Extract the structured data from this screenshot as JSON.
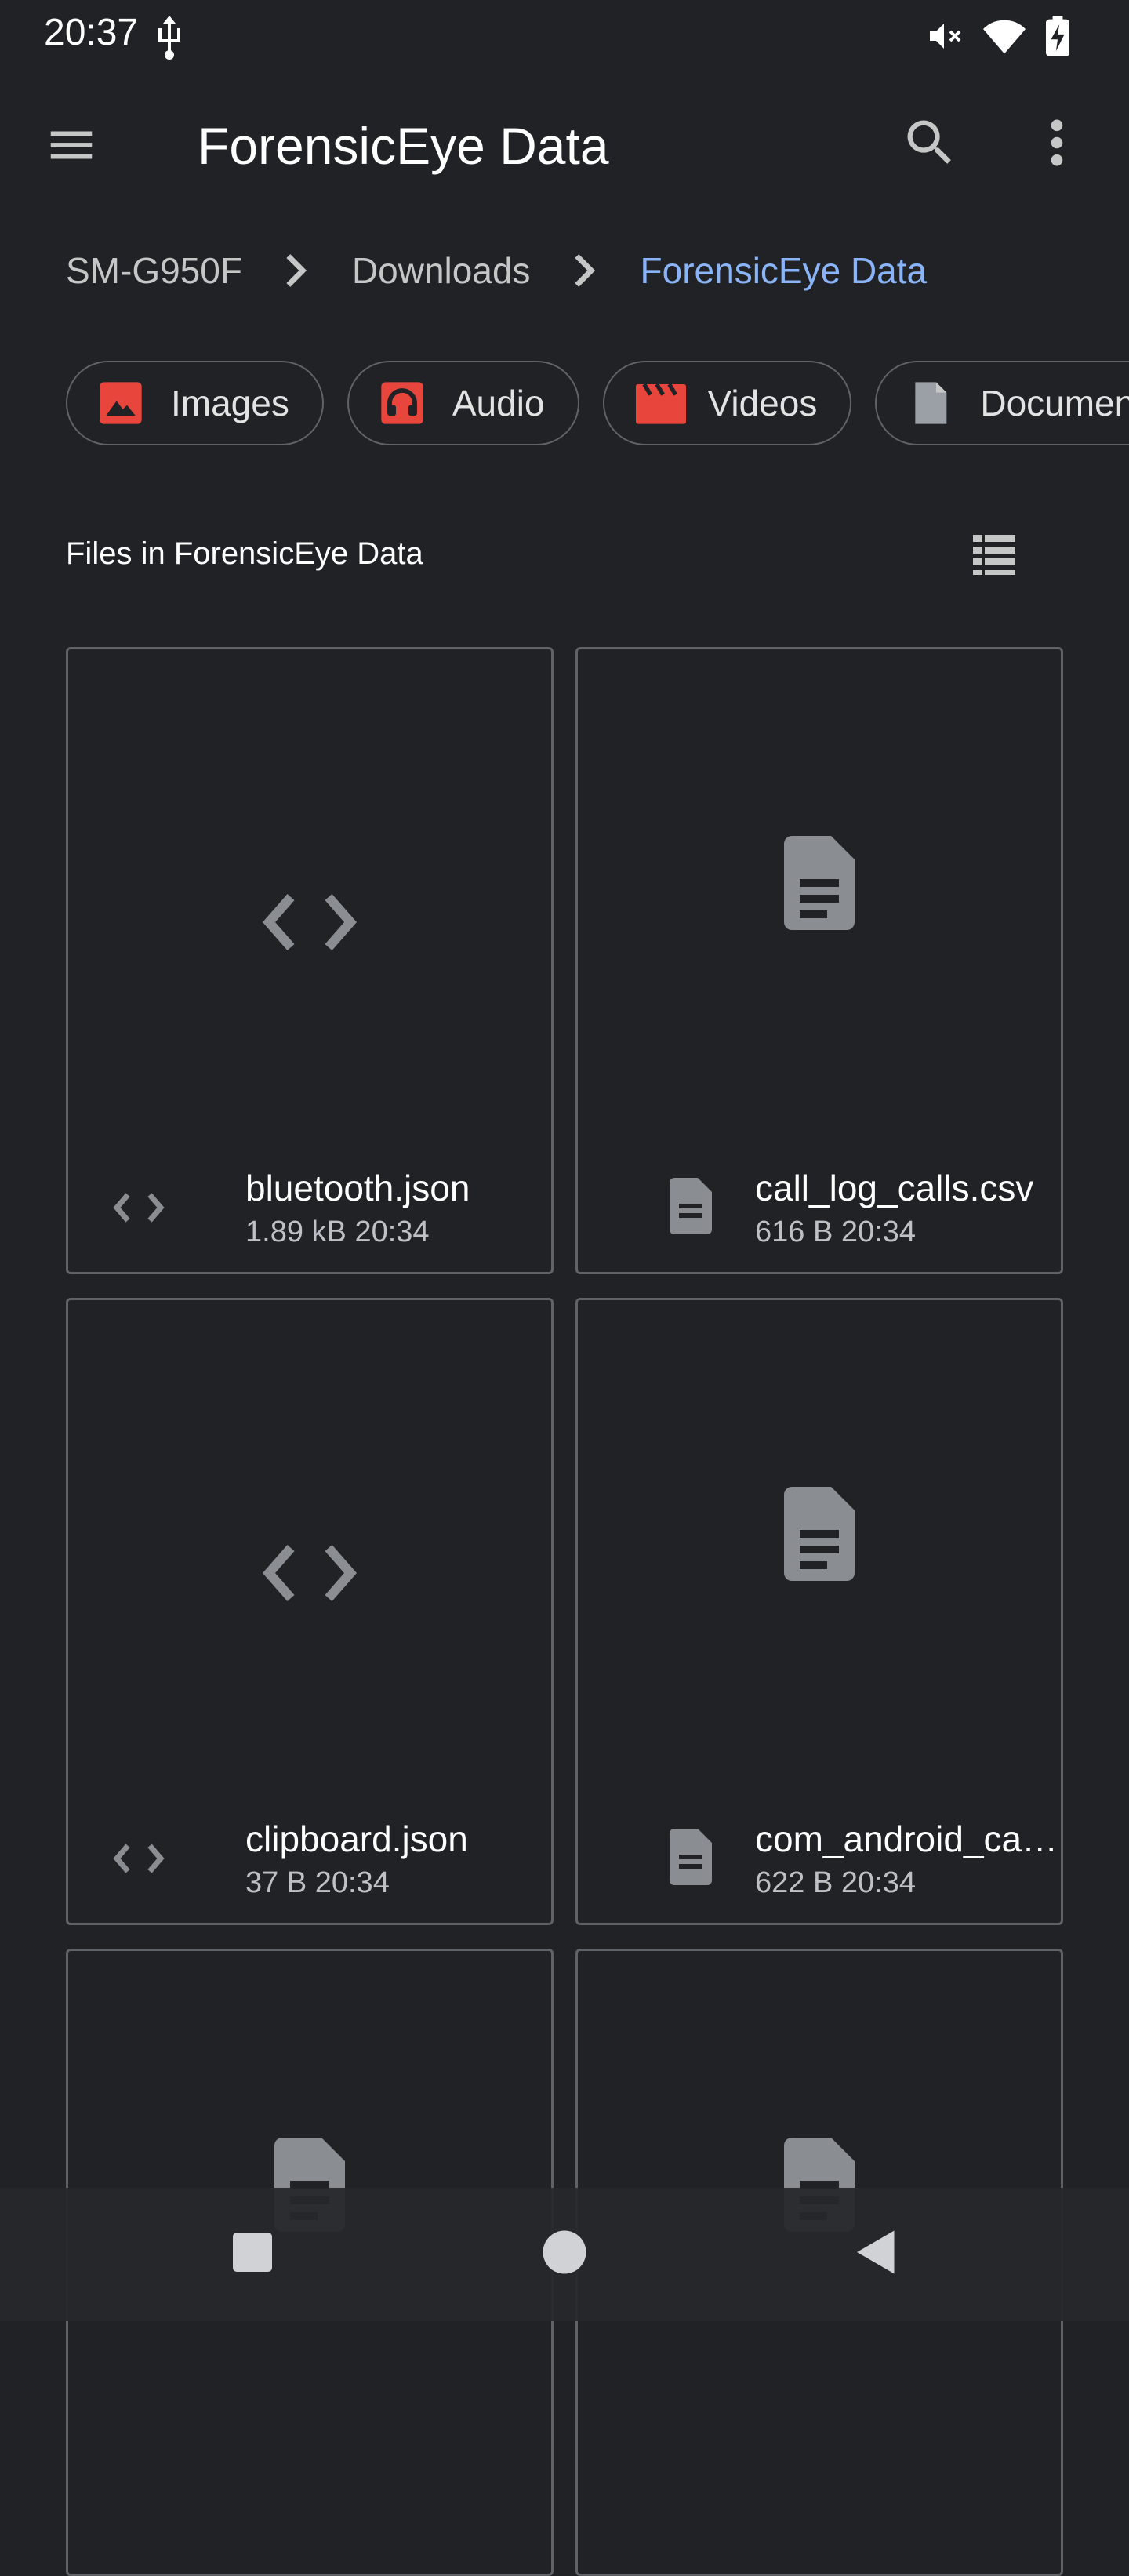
{
  "status": {
    "time": "20:37"
  },
  "app_bar": {
    "title": "ForensicEye Data"
  },
  "breadcrumb": [
    "SM-G950F",
    "Downloads",
    "ForensicEye Data"
  ],
  "chips": [
    {
      "label": "Images",
      "icon": "image-icon",
      "color": "#e8453c"
    },
    {
      "label": "Audio",
      "icon": "headphones-icon",
      "color": "#e8453c"
    },
    {
      "label": "Videos",
      "icon": "movie-icon",
      "color": "#e8453c"
    },
    {
      "label": "Documents",
      "icon": "document-icon",
      "color": "#9aa0a6"
    }
  ],
  "section": {
    "title": "Files in ForensicEye Data"
  },
  "files": [
    {
      "name": "bluetooth.json",
      "size": "1.89 kB",
      "time": "20:34",
      "icon": "code-icon"
    },
    {
      "name": "call_log_calls.csv",
      "size": "616 B",
      "time": "20:34",
      "icon": "document-icon"
    },
    {
      "name": "clipboard.json",
      "size": "37 B",
      "time": "20:34",
      "icon": "code-icon"
    },
    {
      "name": "com_android_ca…",
      "size": "622 B",
      "time": "20:34",
      "icon": "document-icon"
    }
  ],
  "colors": {
    "background": "#212226",
    "accent": "#8ab4f8",
    "border": "#5f6368"
  }
}
